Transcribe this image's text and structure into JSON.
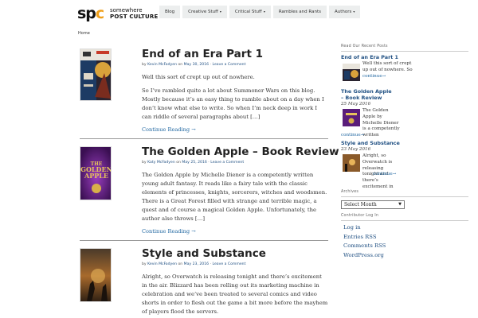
{
  "site": {
    "logo_text_a": "sp",
    "logo_text_b": "c",
    "tagline_1": "somewhere",
    "tagline_2": "POST CULTURE"
  },
  "nav": {
    "items": [
      {
        "label": "Blog",
        "caret": ""
      },
      {
        "label": "Creative Stuff",
        "caret": "▾"
      },
      {
        "label": "Critical Stuff",
        "caret": "▾"
      },
      {
        "label": "Rambles and Rants",
        "caret": ""
      },
      {
        "label": "Authors",
        "caret": "▾"
      }
    ]
  },
  "breadcrumb": "Home",
  "posts": [
    {
      "title": "End of an Era Part 1",
      "by": "by",
      "author": "Kevin McFadyen",
      "on": "on",
      "date": "May 30, 2016",
      "sep": "·",
      "comment": "Leave a Comment",
      "para1": "Well this sort of crept up out of nowhere.",
      "para2": "So I’ve rambled quite a lot about Summoner Wars on this blog. Mostly because it’s an easy thing to ramble about on a day when I don’t know what else to write. So when I’m neck deep in work I can riddle of several paragraphs about […]",
      "read_more": "Continue Reading →"
    },
    {
      "title": "The Golden Apple – Book Review",
      "by": "by",
      "author": "Katy McFadyen",
      "on": "on",
      "date": "May 25, 2016",
      "sep": "·",
      "comment": "Leave a Comment",
      "para1": "The Golden Apple by Michelle Diener is a competently written young adult fantasy. It reads like a fairy tale with the classic elements of princesses, knights, sorcerers, witches and woodsmen. There is a Great Forest filled with strange and terrible magic, a quest and of course a magical Golden Apple. Unfortunately, the author also throws […]",
      "read_more": "Continue Reading →",
      "cover_line1": "THE",
      "cover_line2": "GOLDEN",
      "cover_line3": "APPLE"
    },
    {
      "title": "Style and Substance",
      "by": "by",
      "author": "Kevin McFadyen",
      "on": "on",
      "date": "May 23, 2016",
      "sep": "·",
      "comment": "Leave a Comment",
      "para1": "Alright, so Overwatch is releasing tonight and there’s excitement in the air. Blizzard has been rolling out its marketing machine in celebration and we’ve been treated to several comics and video shorts in order to flesh out the game a bit more before the mayhem of players flood the servers."
    }
  ],
  "sidebar": {
    "recent_title": "Read Our Recent Posts",
    "recent": [
      {
        "title": "End of an Era Part 1",
        "date": "30 May 2016",
        "excerpt": "Well this sort of crept up out of nowhere. So",
        "more": "continue→"
      },
      {
        "title": "The Golden Apple – Book Review",
        "date": "25 May 2016",
        "excerpt": "The Golden Apple by Michelle Diener is a competently written",
        "more": "continue→"
      },
      {
        "title": "Style and Substance",
        "date": "23 May 2016",
        "excerpt": "Alright, so Overwatch is releasing tonight and there’s excitement in",
        "more": "continue→"
      }
    ],
    "archives_title": "Archives",
    "archives_select": "Select Month",
    "login_title": "Contributor Log In",
    "links": [
      "Log in",
      "Entries RSS",
      "Comments RSS",
      "WordPress.org"
    ]
  },
  "colors": {
    "link": "#1f4f82",
    "logo_accent": "#f0a01a",
    "nav_bg": "#eceeee"
  }
}
